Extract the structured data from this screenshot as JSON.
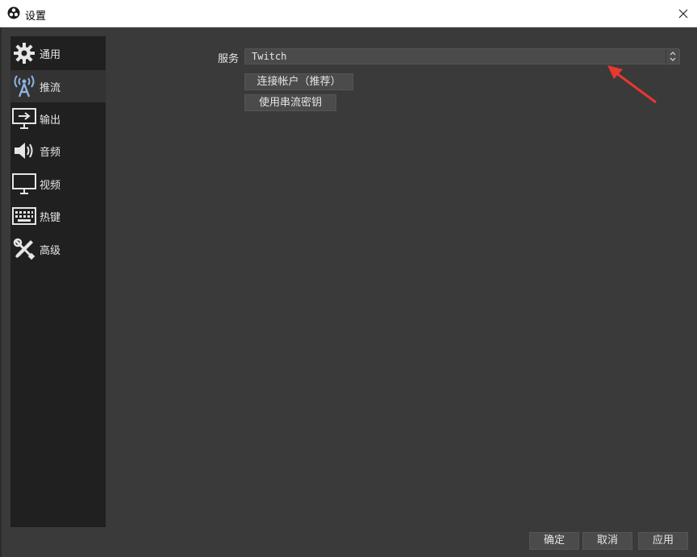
{
  "window": {
    "title": "设置"
  },
  "sidebar": {
    "items": [
      {
        "label": "通用",
        "icon": "gear-icon"
      },
      {
        "label": "推流",
        "icon": "broadcast-antenna-icon",
        "active": true
      },
      {
        "label": "输出",
        "icon": "monitor-output-icon"
      },
      {
        "label": "音频",
        "icon": "speaker-icon"
      },
      {
        "label": "视频",
        "icon": "monitor-icon"
      },
      {
        "label": "热键",
        "icon": "keyboard-icon"
      },
      {
        "label": "高级",
        "icon": "tools-icon"
      }
    ]
  },
  "stream": {
    "service_label": "服务",
    "service_value": "Twitch",
    "connect_button": "连接帐户（推荐）",
    "stream_key_button": "使用串流密钥"
  },
  "footer": {
    "ok": "确定",
    "cancel": "取消",
    "apply": "应用"
  },
  "colors": {
    "background": "#3a3a3a",
    "sidebar": "#202020",
    "annotation": "#e8382f"
  }
}
